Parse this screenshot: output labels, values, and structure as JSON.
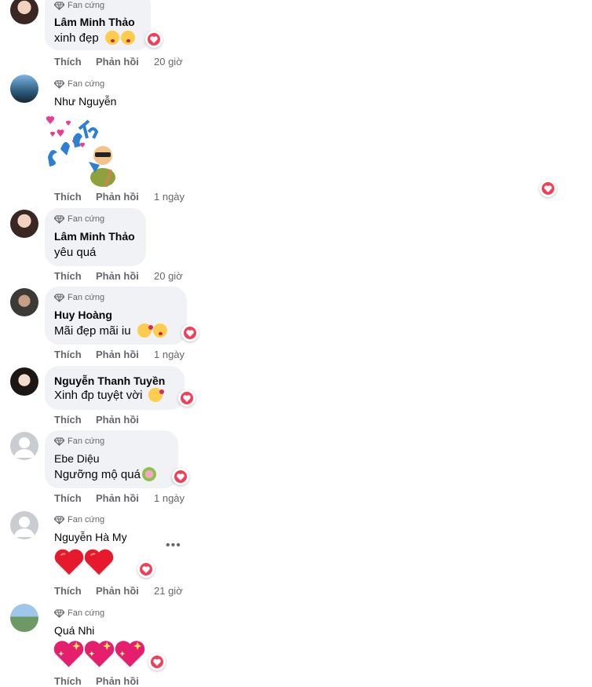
{
  "badge_label": "Fan cứng",
  "action_like": "Thích",
  "action_reply": "Phản hồi",
  "comments": [
    {
      "author": "Lâm Minh Thảo",
      "text": "xinh đẹp",
      "emojis": [
        "kiss-emoji",
        "kiss-emoji"
      ],
      "time": "20 giờ",
      "reaction": "heart"
    },
    {
      "author": "Như Nguyễn",
      "text": "",
      "sticker": "bắn tim",
      "time": "1 ngày",
      "reaction": "heart"
    },
    {
      "author": "Lâm Minh Thảo",
      "text": "yêu quá",
      "time": "20 giờ"
    },
    {
      "author": "Huy Hoàng",
      "text": "Mãi đẹp mãi iu",
      "emojis": [
        "smiling-face-with-hearts-emoji",
        "kiss-emoji"
      ],
      "time": "1 ngày",
      "reaction": "heart"
    },
    {
      "author": "Nguyễn Thanh Tuyền",
      "text": "Xinh đp tuyệt vời",
      "emojis": [
        "smiling-face-with-hearts-emoji"
      ],
      "time": "",
      "reaction": "heart"
    },
    {
      "author": "Ebe Diệu",
      "text": "Ngưỡng mộ quá",
      "emojis": [
        "bouquet-emoji"
      ],
      "time": "1 ngày",
      "reaction": "heart"
    },
    {
      "author": "Nguyễn Hà My",
      "text": "",
      "emojis": [
        "red-heart-emoji",
        "red-heart-emoji"
      ],
      "time": "21 giờ",
      "reaction": "heart"
    },
    {
      "author": "Quá Nhi",
      "text": "",
      "emojis": [
        "sparkling-heart-emoji",
        "sparkling-heart-emoji",
        "sparkling-heart-emoji"
      ],
      "time": "",
      "reaction": "heart"
    }
  ],
  "colors": {
    "bubble": "#f0f2f5",
    "heart": "#f33e58",
    "meta": "#65676b"
  }
}
